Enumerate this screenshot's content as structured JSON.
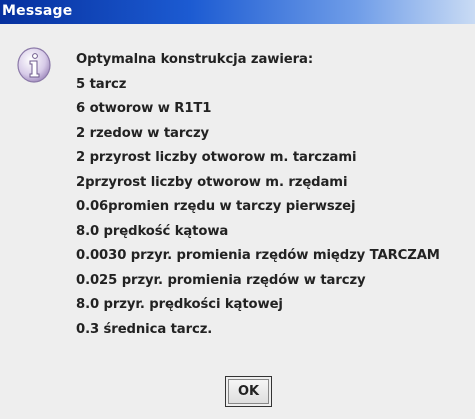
{
  "window": {
    "title": "Message"
  },
  "dialog": {
    "icon": "info-icon",
    "lines": [
      "Optymalna konstrukcja zawiera:",
      "5 tarcz",
      "6 otworow w R1T1",
      "2 rzedow w tarczy",
      "2 przyrost liczby otworow m. tarczami",
      "2przyrost liczby otworow m. rzędami",
      "0.06promien rzędu w tarczy pierwszej",
      "8.0 prędkość kątowa",
      "0.0030 przyr. promienia rzędów między TARCZAM",
      "0.025 przyr. promienia rzędów w tarczy",
      "8.0 przyr. prędkości kątowej",
      "0.3 średnica tarcz."
    ],
    "ok_label": "OK"
  },
  "colors": {
    "titlebar_start": "#06309e",
    "titlebar_end": "#c9dbf4",
    "background": "#eeeeee",
    "text": "#222222"
  }
}
